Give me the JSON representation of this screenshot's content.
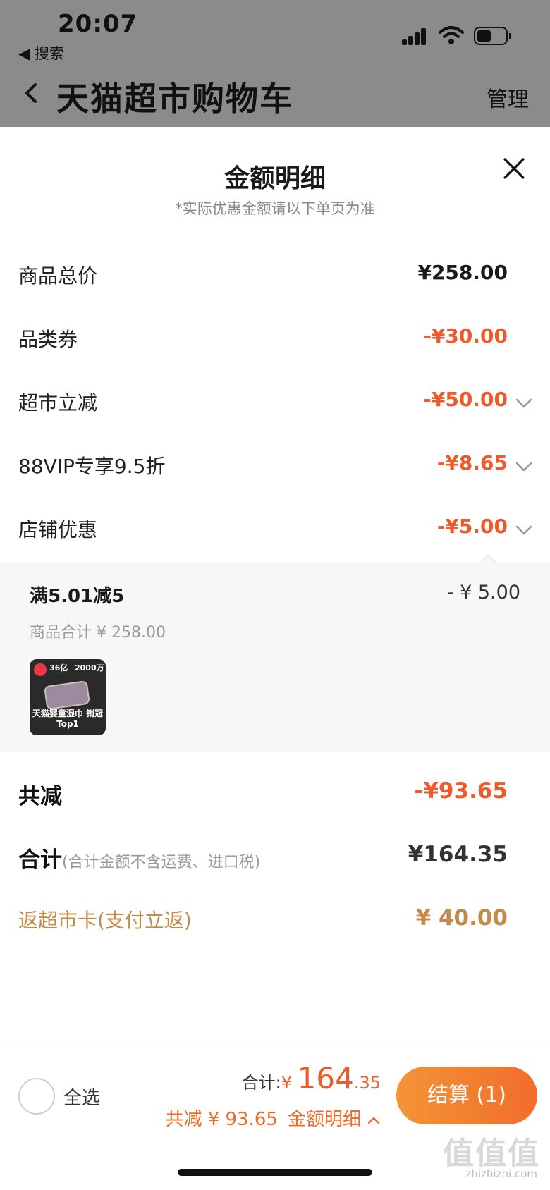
{
  "status_bar": {
    "time": "20:07",
    "back_app": "◀ 搜索"
  },
  "nav": {
    "title": "天猫超市购物车",
    "manage": "管理"
  },
  "sheet": {
    "title": "金额明细",
    "subtitle": "*实际优惠金额请以下单页为准",
    "rows": [
      {
        "label": "商品总价",
        "amount": "¥258.00"
      },
      {
        "label": "品类券",
        "amount": "-¥30.00"
      },
      {
        "label": "超市立减",
        "amount": "-¥50.00"
      },
      {
        "label": "88VIP专享9.5折",
        "amount": "-¥8.65"
      },
      {
        "label": "店铺优惠",
        "amount": "-¥5.00"
      }
    ],
    "promo": {
      "title": "满5.01减5",
      "amount": "- ¥ 5.00",
      "subtotal": "商品合计 ¥ 258.00",
      "thumb_text_1": "36亿",
      "thumb_text_2": "2000万",
      "thumb_caption": "天猫婴童湿巾 销冠Top1"
    },
    "total_discount": {
      "label": "共减",
      "amount": "-¥93.65"
    },
    "total": {
      "label": "合计",
      "note": "(合计金额不含运费、进口税)",
      "amount": "¥164.35"
    },
    "cashback": {
      "label": "返超市卡(支付立返)",
      "amount": "¥ 40.00"
    }
  },
  "bottom_bar": {
    "select_all": "全选",
    "sum_label": "合计:",
    "sum_yen": "¥ ",
    "sum_int": "164",
    "sum_dec": ".35",
    "discount_text": "共减 ¥ 93.65",
    "detail_link": "金额明细",
    "checkout": "结算 (1)"
  },
  "watermark": {
    "main": "值值值",
    "sub": "zhizhizhi.com"
  },
  "colors": {
    "accent": "#ee5a2a",
    "cashback": "#c48a4a",
    "checkout_start": "#f39436",
    "checkout_end": "#f26d2c"
  }
}
